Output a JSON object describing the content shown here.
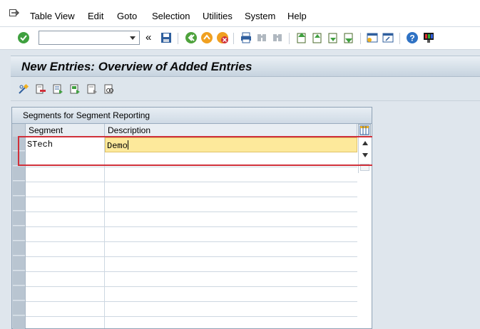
{
  "menu": {
    "items": [
      {
        "label": "Table View",
        "name": "menu-table-view"
      },
      {
        "label": "Edit",
        "name": "menu-edit"
      },
      {
        "label": "Goto",
        "name": "menu-goto"
      },
      {
        "label": "Selection",
        "name": "menu-selection"
      },
      {
        "label": "Utilities",
        "name": "menu-utilities"
      },
      {
        "label": "System",
        "name": "menu-system"
      },
      {
        "label": "Help",
        "name": "menu-help"
      }
    ]
  },
  "toolbar": {
    "command_field_value": "",
    "back_chevron": "«"
  },
  "title": {
    "text": "New Entries: Overview of Added Entries"
  },
  "table": {
    "caption": "Segments for Segment Reporting",
    "columns": [
      "Segment",
      "Description"
    ],
    "rows": [
      {
        "segment": "STech",
        "description": "Demo"
      }
    ]
  },
  "colors": {
    "active_cell": "#fde99b",
    "focus_outline": "#d0303a",
    "title_gradient_top": "#eaf0f5",
    "title_gradient_bottom": "#c6d3df"
  }
}
